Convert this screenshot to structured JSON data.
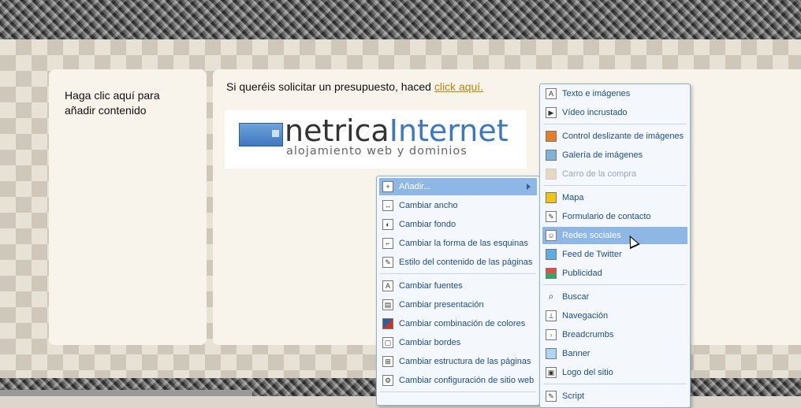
{
  "page": {
    "left_placeholder": "Haga clic aquí para añadir contenido",
    "intro_text": "Si queréis solicitar un presupuesto, haced ",
    "intro_link": "click aquí.",
    "logo": {
      "name_part1": "netrica",
      "name_part2": "Internet",
      "tagline": "alojamiento web y dominios"
    }
  },
  "context_menu": {
    "items": [
      {
        "label": "Añadir...",
        "icon": "add-icon",
        "highlighted": true,
        "submenu": true
      },
      {
        "label": "Cambiar ancho",
        "icon": "width-icon"
      },
      {
        "label": "Cambiar fondo",
        "icon": "background-icon"
      },
      {
        "label": "Cambiar la forma de las esquinas",
        "icon": "corners-icon"
      },
      {
        "label": "Estilo del contenido de las páginas",
        "icon": "content-style-icon"
      },
      {
        "label": "Cambiar fuentes",
        "icon": "fonts-icon"
      },
      {
        "label": "Cambiar presentación",
        "icon": "presentation-icon"
      },
      {
        "label": "Cambiar combinación de colores",
        "icon": "colors-icon"
      },
      {
        "label": "Cambiar bordes",
        "icon": "borders-icon"
      },
      {
        "label": "Cambiar estructura de las páginas",
        "icon": "structure-icon"
      },
      {
        "label": "Cambiar configuración de sitio web",
        "icon": "site-settings-icon"
      }
    ]
  },
  "submenu": {
    "items": [
      {
        "label": "Texto e imágenes",
        "icon": "text-image-icon"
      },
      {
        "label": "Vídeo incrustado",
        "icon": "video-icon"
      },
      {
        "label": "Control deslizante de imágenes",
        "icon": "slider-icon"
      },
      {
        "label": "Galería de imágenes",
        "icon": "gallery-icon"
      },
      {
        "label": "Carro de la compra",
        "icon": "cart-icon",
        "disabled": true
      },
      {
        "label": "Mapa",
        "icon": "map-icon"
      },
      {
        "label": "Formulario de contacto",
        "icon": "form-icon"
      },
      {
        "label": "Redes sociales",
        "icon": "social-icon",
        "highlighted": true
      },
      {
        "label": "Feed de Twitter",
        "icon": "twitter-icon"
      },
      {
        "label": "Publicidad",
        "icon": "ads-icon"
      },
      {
        "label": "Buscar",
        "icon": "search-icon"
      },
      {
        "label": "Navegación",
        "icon": "navigation-icon"
      },
      {
        "label": "Breadcrumbs",
        "icon": "breadcrumbs-icon"
      },
      {
        "label": "Banner",
        "icon": "banner-icon"
      },
      {
        "label": "Logo del sitio",
        "icon": "logo-icon"
      },
      {
        "label": "Script",
        "icon": "script-icon"
      }
    ]
  },
  "colors": {
    "menu_text": "#1f4e8c",
    "highlight": "#8fb7e6",
    "link": "#b8860b"
  }
}
